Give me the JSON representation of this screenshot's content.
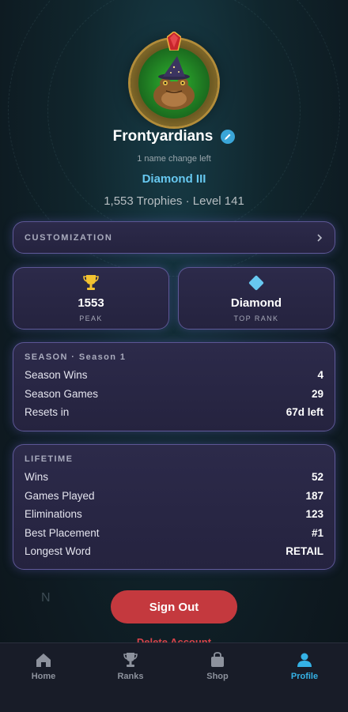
{
  "profile": {
    "name": "Frontyardians",
    "name_change_note": "1 name change left",
    "rank_name": "Diamond III",
    "trophies_line": "1,553 Trophies · Level 141"
  },
  "customization": {
    "label": "CUSTOMIZATION"
  },
  "stats": {
    "peak": {
      "value": "1553",
      "label": "PEAK",
      "icon": "trophy-icon"
    },
    "top_rank": {
      "value": "Diamond",
      "label": "TOP RANK",
      "icon": "diamond-icon"
    }
  },
  "season": {
    "title": "SEASON · Season 1",
    "rows": [
      {
        "label": "Season Wins",
        "value": "4"
      },
      {
        "label": "Season Games",
        "value": "29"
      },
      {
        "label": "Resets in",
        "value": "67d left"
      }
    ]
  },
  "lifetime": {
    "title": "LIFETIME",
    "rows": [
      {
        "label": "Wins",
        "value": "52"
      },
      {
        "label": "Games Played",
        "value": "187"
      },
      {
        "label": "Eliminations",
        "value": "123"
      },
      {
        "label": "Best Placement",
        "value": "#1"
      },
      {
        "label": "Longest Word",
        "value": "RETAIL"
      }
    ]
  },
  "actions": {
    "sign_out": "Sign Out",
    "delete_account": "Delete Account"
  },
  "background": {
    "compass_letter": "N"
  },
  "tabs": [
    {
      "label": "Home",
      "icon": "home-icon"
    },
    {
      "label": "Ranks",
      "icon": "trophy-icon"
    },
    {
      "label": "Shop",
      "icon": "shopping-bag-icon"
    },
    {
      "label": "Profile",
      "icon": "person-icon",
      "active": true
    }
  ],
  "colors": {
    "accent": "#35b2e6",
    "rank": "#67c8f0",
    "danger": "#c4393e",
    "card_border": "#8c82dc"
  }
}
